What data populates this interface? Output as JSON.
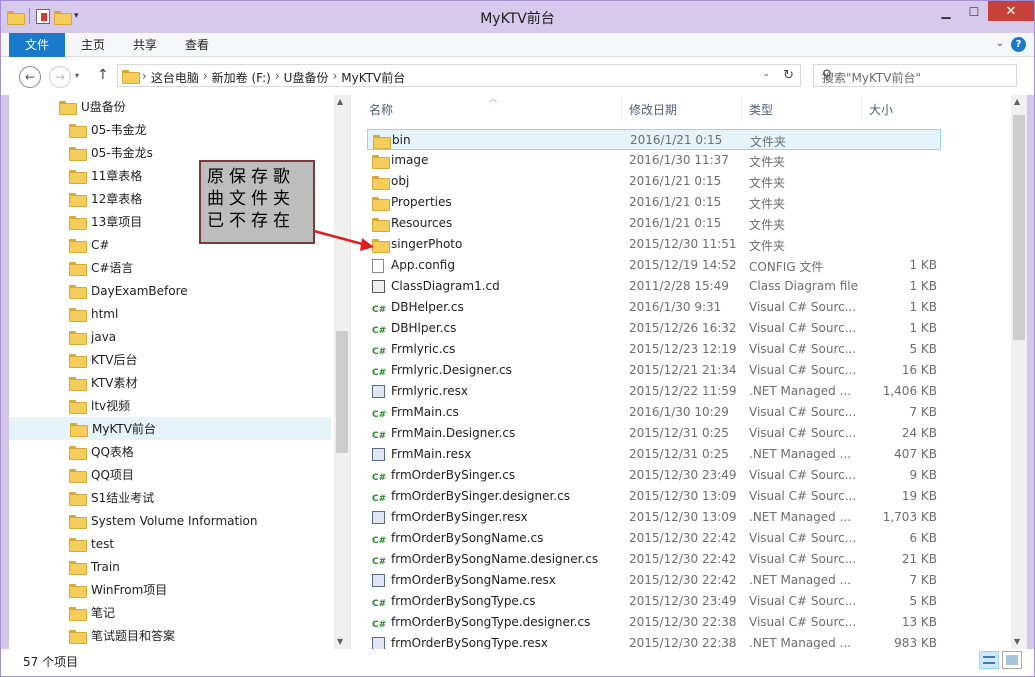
{
  "window": {
    "title": "MyKTV前台"
  },
  "ribbon": {
    "tabs": [
      "文件",
      "主页",
      "共享",
      "查看"
    ],
    "help": "?"
  },
  "address": {
    "crumbs": [
      "这台电脑",
      "新加卷 (F:)",
      "U盘备份",
      "MyKTV前台"
    ]
  },
  "search": {
    "placeholder": "搜索\"MyKTV前台\""
  },
  "tree": {
    "parent": "U盘备份",
    "items": [
      "05-韦金龙",
      "05-韦金龙s",
      "11章表格",
      "12章表格",
      "13章项目",
      "C#",
      "C#语言",
      "DayExamBefore",
      "html",
      "java",
      "KTV后台",
      "KTV素材",
      "ltv视频",
      "MyKTV前台",
      "QQ表格",
      "QQ项目",
      "S1结业考试",
      "System Volume Information",
      "test",
      "Train",
      "WinFrom项目",
      "笔记",
      "笔试题目和答案"
    ],
    "selected": "MyKTV前台"
  },
  "columns": {
    "name": "名称",
    "date": "修改日期",
    "type": "类型",
    "size": "大小"
  },
  "files": [
    {
      "icon": "folder",
      "name": "bin",
      "date": "2016/1/21 0:15",
      "type": "文件夹",
      "size": ""
    },
    {
      "icon": "folder",
      "name": "image",
      "date": "2016/1/30 11:37",
      "type": "文件夹",
      "size": ""
    },
    {
      "icon": "folder",
      "name": "obj",
      "date": "2016/1/21 0:15",
      "type": "文件夹",
      "size": ""
    },
    {
      "icon": "folder",
      "name": "Properties",
      "date": "2016/1/21 0:15",
      "type": "文件夹",
      "size": ""
    },
    {
      "icon": "folder",
      "name": "Resources",
      "date": "2016/1/21 0:15",
      "type": "文件夹",
      "size": ""
    },
    {
      "icon": "folder",
      "name": "singerPhoto",
      "date": "2015/12/30 11:51",
      "type": "文件夹",
      "size": ""
    },
    {
      "icon": "config",
      "name": "App.config",
      "date": "2015/12/19 14:52",
      "type": "CONFIG 文件",
      "size": "1 KB"
    },
    {
      "icon": "diagram",
      "name": "ClassDiagram1.cd",
      "date": "2011/2/28 15:49",
      "type": "Class Diagram file",
      "size": "1 KB"
    },
    {
      "icon": "cs",
      "name": "DBHelper.cs",
      "date": "2016/1/30 9:31",
      "type": "Visual C# Sourc...",
      "size": "1 KB"
    },
    {
      "icon": "cs",
      "name": "DBHlper.cs",
      "date": "2015/12/26 16:32",
      "type": "Visual C# Sourc...",
      "size": "1 KB"
    },
    {
      "icon": "cs",
      "name": "Frmlyric.cs",
      "date": "2015/12/23 12:19",
      "type": "Visual C# Sourc...",
      "size": "5 KB"
    },
    {
      "icon": "cs",
      "name": "Frmlyric.Designer.cs",
      "date": "2015/12/21 21:34",
      "type": "Visual C# Sourc...",
      "size": "16 KB"
    },
    {
      "icon": "resx",
      "name": "Frmlyric.resx",
      "date": "2015/12/22 11:59",
      "type": ".NET Managed ...",
      "size": "1,406 KB"
    },
    {
      "icon": "cs",
      "name": "FrmMain.cs",
      "date": "2016/1/30 10:29",
      "type": "Visual C# Sourc...",
      "size": "7 KB"
    },
    {
      "icon": "cs",
      "name": "FrmMain.Designer.cs",
      "date": "2015/12/31 0:25",
      "type": "Visual C# Sourc...",
      "size": "24 KB"
    },
    {
      "icon": "resx",
      "name": "FrmMain.resx",
      "date": "2015/12/31 0:25",
      "type": ".NET Managed ...",
      "size": "407 KB"
    },
    {
      "icon": "cs",
      "name": "frmOrderBySinger.cs",
      "date": "2015/12/30 23:49",
      "type": "Visual C# Sourc...",
      "size": "9 KB"
    },
    {
      "icon": "cs",
      "name": "frmOrderBySinger.designer.cs",
      "date": "2015/12/30 13:09",
      "type": "Visual C# Sourc...",
      "size": "19 KB"
    },
    {
      "icon": "resx",
      "name": "frmOrderBySinger.resx",
      "date": "2015/12/30 13:09",
      "type": ".NET Managed ...",
      "size": "1,703 KB"
    },
    {
      "icon": "cs",
      "name": "frmOrderBySongName.cs",
      "date": "2015/12/30 22:42",
      "type": "Visual C# Sourc...",
      "size": "6 KB"
    },
    {
      "icon": "cs",
      "name": "frmOrderBySongName.designer.cs",
      "date": "2015/12/30 22:42",
      "type": "Visual C# Sourc...",
      "size": "21 KB"
    },
    {
      "icon": "resx",
      "name": "frmOrderBySongName.resx",
      "date": "2015/12/30 22:42",
      "type": ".NET Managed ...",
      "size": "7 KB"
    },
    {
      "icon": "cs",
      "name": "frmOrderBySongType.cs",
      "date": "2015/12/30 23:49",
      "type": "Visual C# Sourc...",
      "size": "5 KB"
    },
    {
      "icon": "cs",
      "name": "frmOrderBySongType.designer.cs",
      "date": "2015/12/30 22:38",
      "type": "Visual C# Sourc...",
      "size": "13 KB"
    },
    {
      "icon": "resx",
      "name": "frmOrderBySongType.resx",
      "date": "2015/12/30 22:38",
      "type": ".NET Managed ...",
      "size": "983 KB"
    }
  ],
  "status": {
    "count": "57 个项目"
  },
  "annotation": {
    "lines": [
      "原保存歌",
      "曲文件夹",
      "已不存在"
    ],
    "arrow_color": "#e02020"
  }
}
